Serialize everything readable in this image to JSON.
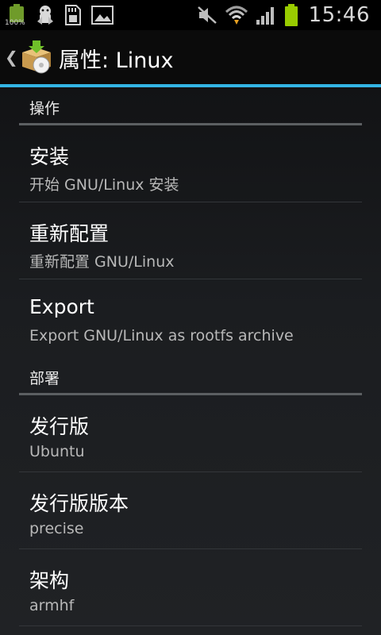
{
  "status_bar": {
    "battery_small_label": "100%",
    "time": "15:46",
    "icons": [
      "battery-icon",
      "android-icon",
      "sd-card-icon",
      "image-icon",
      "mute-icon",
      "wifi-icon",
      "signal-icon",
      "battery-icon"
    ],
    "battery_color": "#99cc00"
  },
  "action_bar": {
    "title": "属性: Linux",
    "accent_color": "#33b5e5"
  },
  "sections": [
    {
      "header": "操作",
      "items": [
        {
          "title": "安装",
          "summary": "开始 GNU/Linux 安装"
        },
        {
          "title": "重新配置",
          "summary": "重新配置 GNU/Linux"
        },
        {
          "title": "Export",
          "summary": "Export GNU/Linux as rootfs archive"
        }
      ]
    },
    {
      "header": "部署",
      "items": [
        {
          "title": "发行版",
          "summary": "Ubuntu"
        },
        {
          "title": "发行版版本",
          "summary": "precise"
        },
        {
          "title": "架构",
          "summary": "armhf"
        }
      ]
    }
  ]
}
